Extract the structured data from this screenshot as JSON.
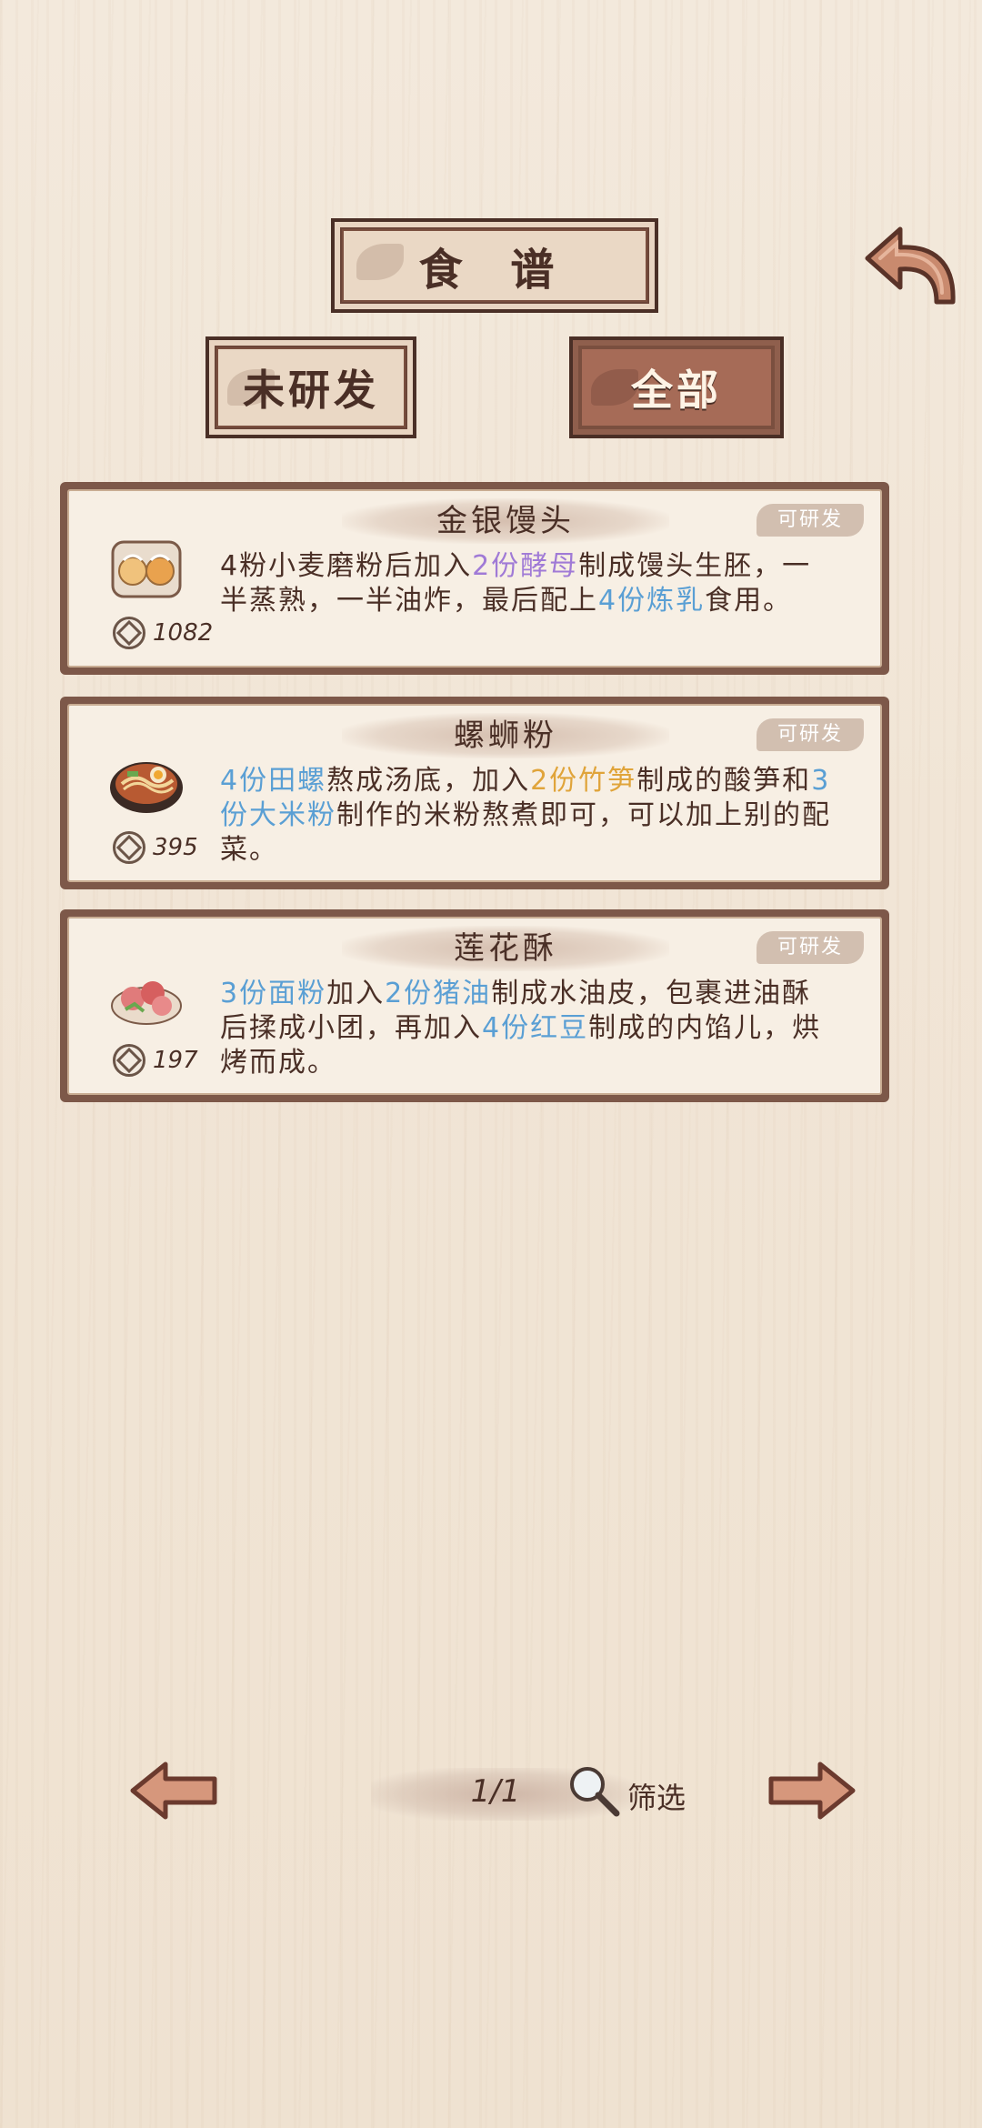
{
  "header": {
    "title": "食 谱",
    "tabs": [
      {
        "label": "未研发",
        "active": false
      },
      {
        "label": "全部",
        "active": true
      }
    ],
    "back_icon": "back-arrow-icon"
  },
  "recipes": [
    {
      "name": "金银馒头",
      "badge": "可研发",
      "price": "1082",
      "desc": [
        {
          "t": "4粉小麦磨粉后加入",
          "c": ""
        },
        {
          "t": "2份酵母",
          "c": "purple"
        },
        {
          "t": "制成馒头生胚，一半蒸熟，一半油炸，最后配上",
          "c": ""
        },
        {
          "t": "4份炼乳",
          "c": "blue"
        },
        {
          "t": "食用。",
          "c": ""
        }
      ]
    },
    {
      "name": "螺蛳粉",
      "badge": "可研发",
      "price": "395",
      "desc": [
        {
          "t": "4份田螺",
          "c": "blue"
        },
        {
          "t": "熬成汤底，加入",
          "c": ""
        },
        {
          "t": "2份竹笋",
          "c": "orange"
        },
        {
          "t": "制成的酸笋和",
          "c": ""
        },
        {
          "t": "3份大米粉",
          "c": "blue"
        },
        {
          "t": "制作的米粉熬煮即可，可以加上别的配菜。",
          "c": ""
        }
      ]
    },
    {
      "name": "莲花酥",
      "badge": "可研发",
      "price": "197",
      "desc": [
        {
          "t": "3份面粉",
          "c": "blue"
        },
        {
          "t": "加入",
          "c": ""
        },
        {
          "t": "2份猪油",
          "c": "blue"
        },
        {
          "t": "制成水油皮，包裹进油酥后揉成小团，再加入",
          "c": ""
        },
        {
          "t": "4份红豆",
          "c": "blue"
        },
        {
          "t": "制成的内馅儿，烘烤而成。",
          "c": ""
        }
      ]
    }
  ],
  "pager": {
    "page": "1/1",
    "filter_label": "筛选"
  },
  "colors": {
    "frame": "#7d5849",
    "paper": "#f7efe4",
    "text": "#4a2f26",
    "highlight_blue": "#5a9fd4",
    "highlight_purple": "#a07ad6",
    "highlight_orange": "#e0a43a"
  }
}
